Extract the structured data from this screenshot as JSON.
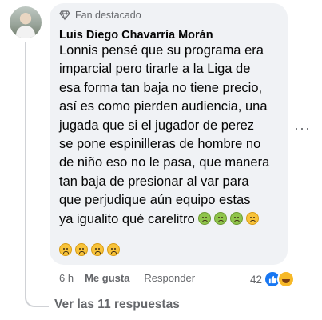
{
  "comment": {
    "badge": "Fan destacado",
    "author": "Luis Diego Chavarría Morán",
    "lines": [
      "Lonnis pensé que su programa era",
      "imparcial pero tirarle a la Liga de",
      "esa forma tan baja no tiene precio,",
      "así es como pierden audiencia, una",
      "jugada que si el jugador de perez",
      "se pone espinilleras de hombre no",
      "de niño eso no le pasa, que manera",
      "tan baja de presionar al var para",
      "que perjudique aún equipo estas",
      "ya igualito qué carelitro"
    ],
    "time": "6 h",
    "like_label": "Me gusta",
    "reply_label": "Responder",
    "reaction_count": "42",
    "more_label": "···"
  },
  "view_replies_label": "Ver las 11 respuestas",
  "colors": {
    "bubble": "#f0f2f5",
    "secondary_text": "#65676b",
    "like_blue": "#1877f2",
    "emoji_green": "#8fc44b",
    "emoji_yellow": "#f8c33a"
  },
  "icons": [
    "gem-icon",
    "nauseated-face-icon",
    "nauseated-face-icon",
    "nauseated-face-icon",
    "vomiting-face-icon",
    "vomiting-face-icon",
    "vomiting-face-icon",
    "vomiting-face-icon",
    "vomiting-face-icon",
    "like-reaction-icon",
    "haha-reaction-icon",
    "more-options-icon"
  ]
}
